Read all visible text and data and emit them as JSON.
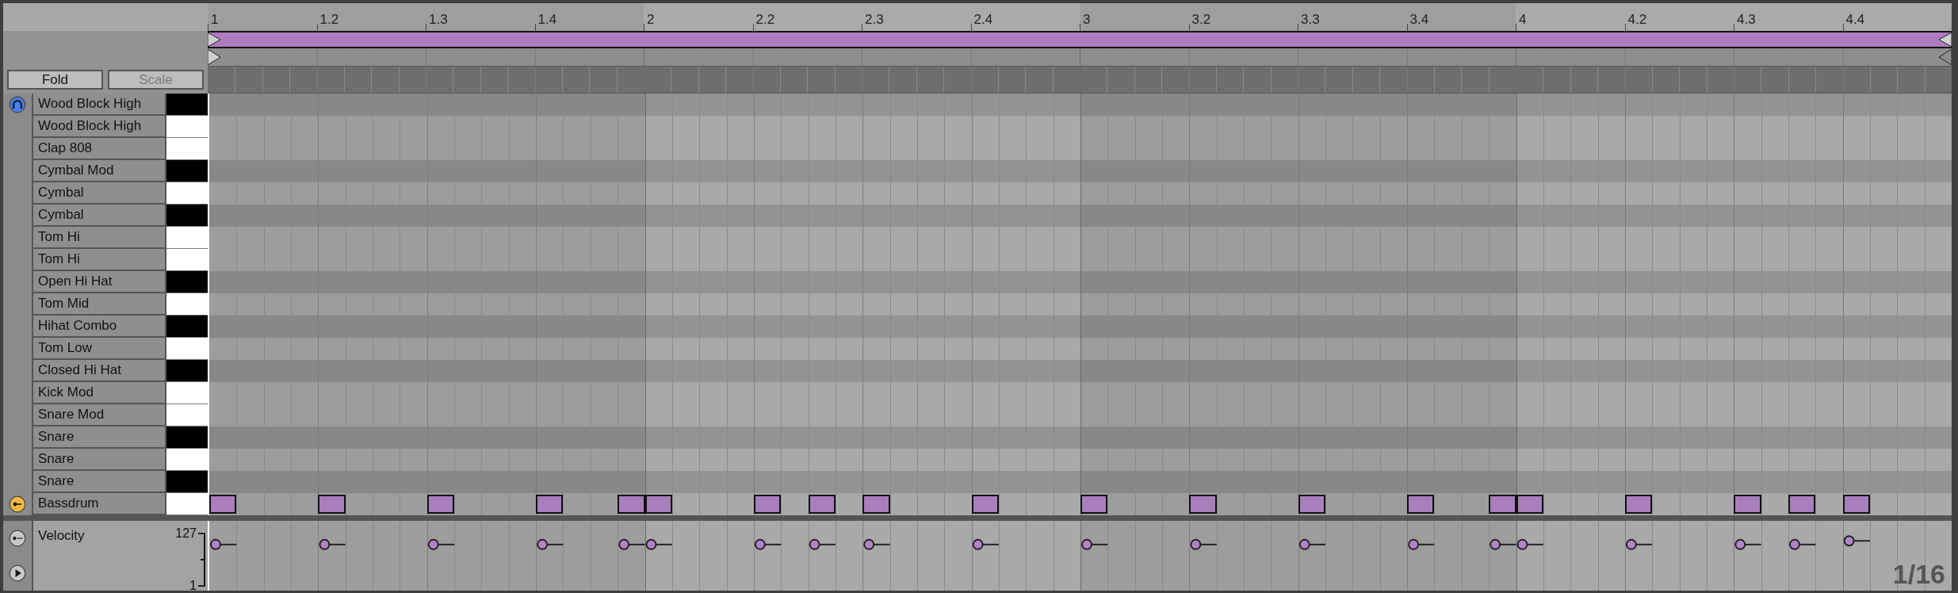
{
  "ruler": {
    "labels": [
      "1",
      "1.2",
      "1.3",
      "1.4",
      "2",
      "2.2",
      "2.3",
      "2.4",
      "3",
      "3.2",
      "3.3",
      "3.4",
      "4",
      "4.2",
      "4.3",
      "4.4"
    ]
  },
  "buttons": [
    {
      "label": "Fold",
      "disabled": false
    },
    {
      "label": "Scale",
      "disabled": true
    }
  ],
  "gutter_buttons": [
    {
      "kind": "preview",
      "on": true
    },
    {
      "kind": "key",
      "on": true
    },
    {
      "kind": "lane",
      "on": false
    },
    {
      "kind": "play",
      "on": false
    }
  ],
  "rows": [
    {
      "name": "Wood Block High",
      "black": true,
      "kind": "plain"
    },
    {
      "name": "Wood Block High",
      "black": false,
      "kind": "plain"
    },
    {
      "name": "Clap 808",
      "black": false,
      "kind": "plain"
    },
    {
      "name": "Cymbal Mod",
      "black": true,
      "kind": "plain"
    },
    {
      "name": "Cymbal",
      "black": false,
      "kind": "plain"
    },
    {
      "name": "Cymbal",
      "black": true,
      "kind": "plain"
    },
    {
      "name": "Tom Hi",
      "black": false,
      "kind": "plain"
    },
    {
      "name": "Tom Hi",
      "black": false,
      "kind": "plain"
    },
    {
      "name": "Open Hi Hat",
      "black": true,
      "kind": "plain"
    },
    {
      "name": "Tom Mid",
      "black": false,
      "kind": "plain"
    },
    {
      "name": "Hihat Combo",
      "black": true,
      "kind": "plain"
    },
    {
      "name": "Tom Low",
      "black": false,
      "kind": "plain"
    },
    {
      "name": "Closed Hi Hat",
      "black": true,
      "kind": "plain"
    },
    {
      "name": "Kick Mod",
      "black": false,
      "kind": "plain"
    },
    {
      "name": "Snare Mod",
      "black": false,
      "kind": "plain"
    },
    {
      "name": "Snare",
      "black": true,
      "kind": "plain"
    },
    {
      "name": "Snare",
      "black": false,
      "kind": "plain"
    },
    {
      "name": "Snare",
      "black": true,
      "kind": "plain"
    },
    {
      "name": "Bassdrum",
      "black": false,
      "kind": "notes"
    }
  ],
  "velocity_lane": {
    "label": "Velocity",
    "max": "127",
    "min": "1"
  },
  "grid_label": "1/16"
}
